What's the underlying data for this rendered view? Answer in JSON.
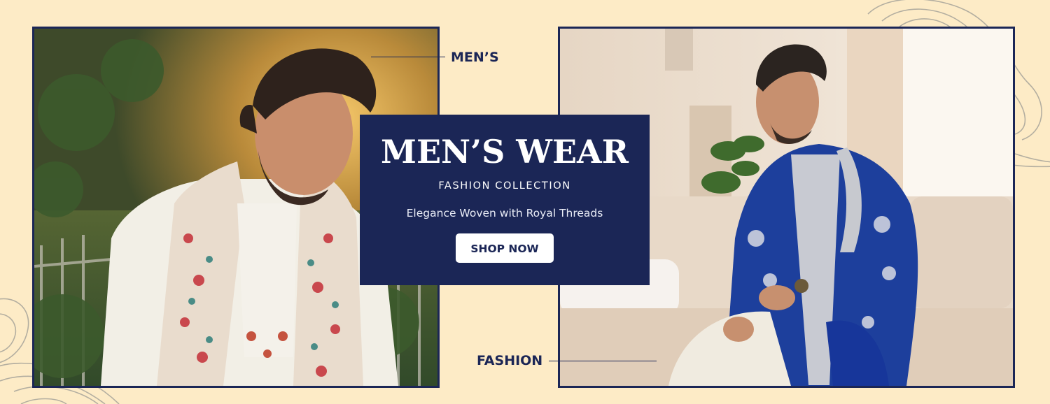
{
  "banner": {
    "callout_top": "MEN’S",
    "callout_bottom": "FASHION",
    "promo": {
      "title": "MEN’S WEAR",
      "subtitle": "FASHION COLLECTION",
      "tagline": "Elegance Woven with Royal Threads",
      "cta_label": "SHOP NOW"
    },
    "photos": {
      "left": {
        "description_icon": "man-in-white-kurta-with-embroidered-shawl"
      },
      "right": {
        "description_icon": "man-in-blue-embroidered-sherwani-on-sofa"
      }
    }
  },
  "colors": {
    "background": "#fdebc6",
    "navy": "#1b2656",
    "white": "#ffffff"
  }
}
